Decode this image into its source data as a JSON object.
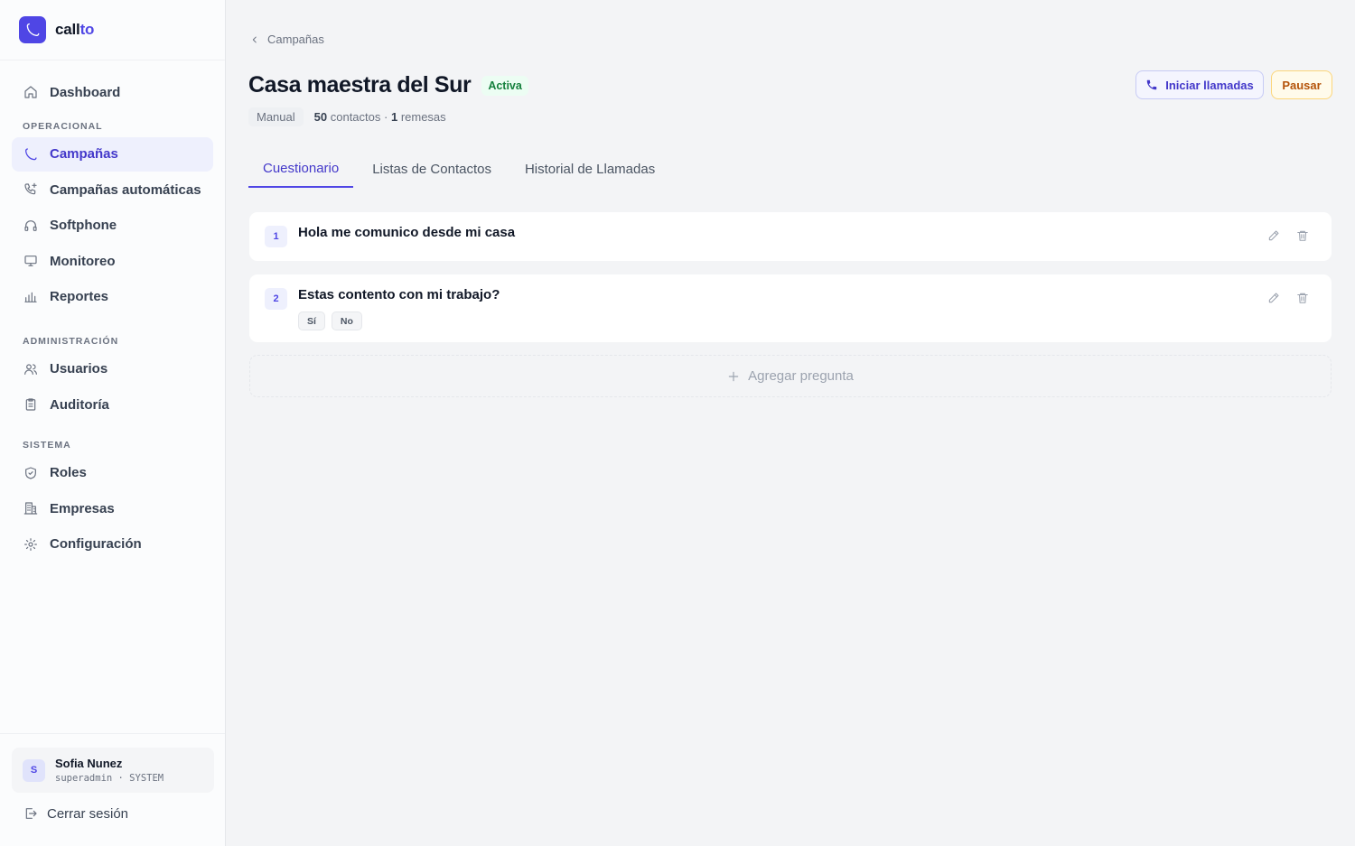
{
  "app": {
    "name_main": "call",
    "name_accent": "to",
    "brand_color": "#4f46e5"
  },
  "sidebar": {
    "top": [
      {
        "label": "Dashboard",
        "icon": "home-icon"
      }
    ],
    "sections": [
      {
        "title": "OPERACIONAL",
        "items": [
          {
            "label": "Campañas",
            "icon": "phone-icon",
            "active": true
          },
          {
            "label": "Campañas automáticas",
            "icon": "phone-plus-icon"
          },
          {
            "label": "Softphone",
            "icon": "headset-icon"
          },
          {
            "label": "Monitoreo",
            "icon": "monitor-icon"
          },
          {
            "label": "Reportes",
            "icon": "bar-chart-icon"
          }
        ]
      },
      {
        "title": "ADMINISTRACIÓN",
        "items": [
          {
            "label": "Usuarios",
            "icon": "users-icon"
          },
          {
            "label": "Auditoría",
            "icon": "clipboard-icon"
          }
        ]
      },
      {
        "title": "SISTEMA",
        "items": [
          {
            "label": "Roles",
            "icon": "shield-icon"
          },
          {
            "label": "Empresas",
            "icon": "building-icon"
          },
          {
            "label": "Configuración",
            "icon": "gear-icon"
          }
        ]
      }
    ],
    "user": {
      "initial": "S",
      "name": "Sofia Nunez",
      "role": "superadmin · SYSTEM"
    },
    "logout_label": "Cerrar sesión"
  },
  "breadcrumb": {
    "label": "Campañas"
  },
  "campaign": {
    "title": "Casa maestra del Sur",
    "status": "Activa",
    "mode": "Manual",
    "contacts_count": "50",
    "contacts_label": "contactos ·",
    "batches_count": "1",
    "batches_label": "remesas"
  },
  "actions": {
    "start_label": "Iniciar llamadas",
    "pause_label": "Pausar"
  },
  "tabs": [
    {
      "label": "Cuestionario",
      "active": true
    },
    {
      "label": "Listas de Contactos"
    },
    {
      "label": "Historial de Llamadas"
    }
  ],
  "questions": [
    {
      "number": "1",
      "text": "Hola me comunico desde mi casa",
      "options": []
    },
    {
      "number": "2",
      "text": "Estas contento con mi trabajo?",
      "options": [
        "Sí",
        "No"
      ]
    }
  ],
  "add_question_label": "Agregar pregunta"
}
